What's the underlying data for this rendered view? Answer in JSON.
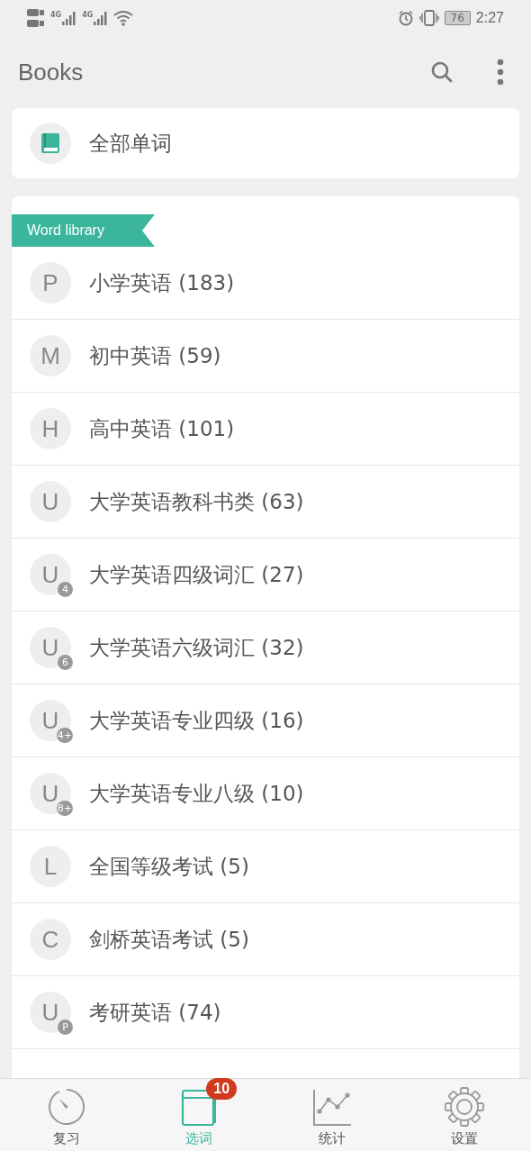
{
  "status_bar": {
    "networks": [
      "4G",
      "4G"
    ],
    "battery": "76",
    "time": "2:27"
  },
  "header": {
    "title": "Books"
  },
  "all_words": {
    "label": "全部单词"
  },
  "library": {
    "ribbon": "Word library",
    "items": [
      {
        "letter": "P",
        "label": "小学英语 (183)"
      },
      {
        "letter": "M",
        "label": "初中英语 (59)"
      },
      {
        "letter": "H",
        "label": "高中英语 (101)"
      },
      {
        "letter": "U",
        "label": "大学英语教科书类 (63)"
      },
      {
        "letter": "U",
        "badge": "4",
        "label": "大学英语四级词汇 (27)"
      },
      {
        "letter": "U",
        "badge": "6",
        "label": "大学英语六级词汇 (32)"
      },
      {
        "letter": "U",
        "badge": "4+",
        "label": "大学英语专业四级 (16)"
      },
      {
        "letter": "U",
        "badge": "8+",
        "label": "大学英语专业八级 (10)"
      },
      {
        "letter": "L",
        "label": "全国等级考试 (5)"
      },
      {
        "letter": "C",
        "label": "剑桥英语考试 (5)"
      },
      {
        "letter": "U",
        "badge": "P",
        "label": "考研英语 (74)"
      }
    ]
  },
  "tabs": [
    {
      "kind": "review",
      "label": "复习",
      "selected": false
    },
    {
      "kind": "pick",
      "label": "选词",
      "selected": true,
      "badge": "10"
    },
    {
      "kind": "stats",
      "label": "统计",
      "selected": false
    },
    {
      "kind": "settings",
      "label": "设置",
      "selected": false
    }
  ]
}
